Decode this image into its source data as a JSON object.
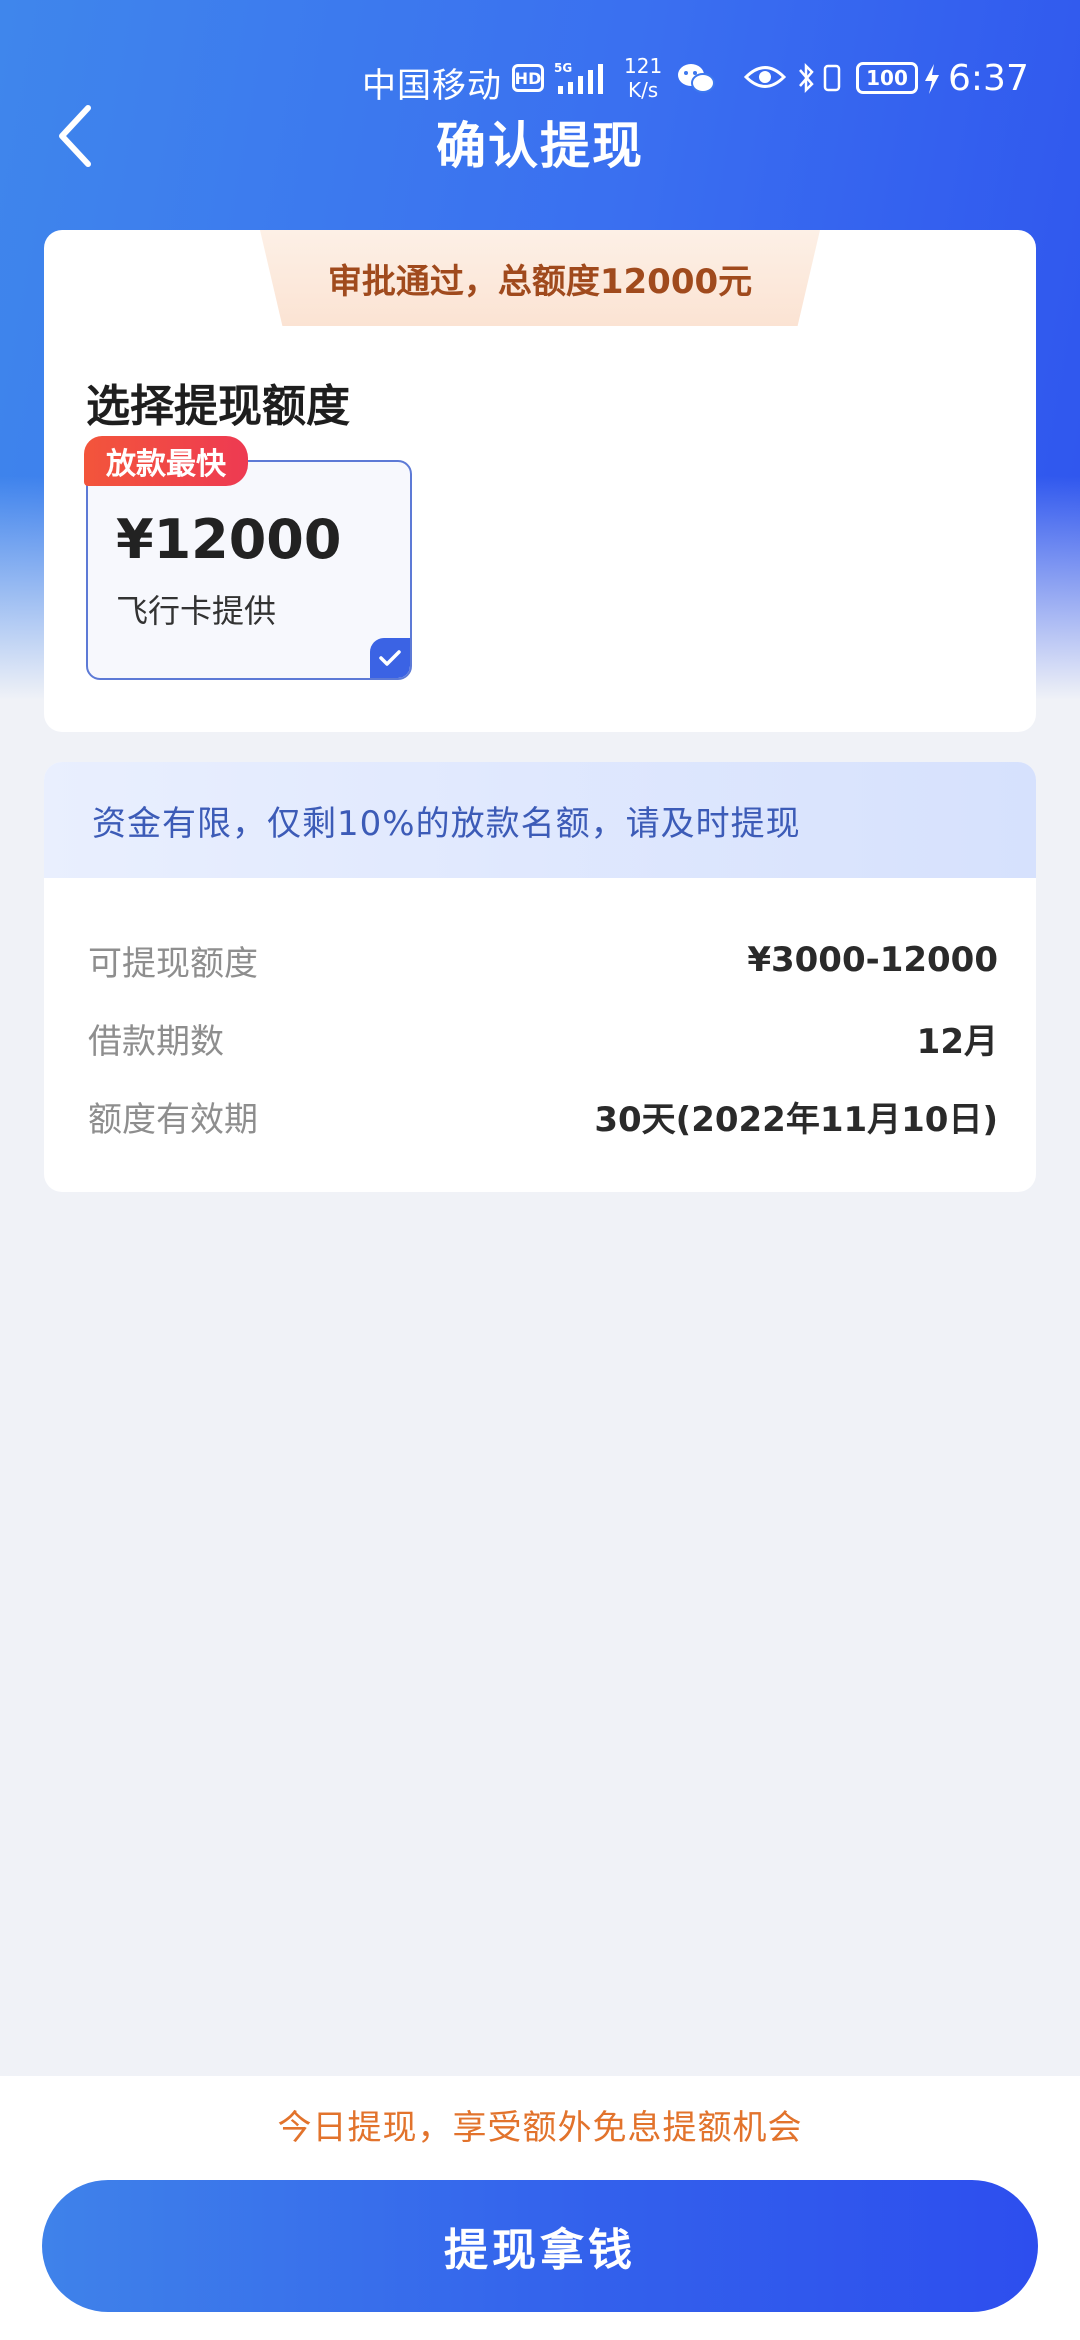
{
  "status_bar": {
    "carrier": "中国移动",
    "hd": "HD",
    "network": "5G",
    "speed_value": "121",
    "speed_unit": "K/s",
    "battery": "100",
    "time": "6:37",
    "icons": [
      "hd-icon",
      "signal-icon",
      "wechat-icon",
      "eye-icon",
      "bluetooth-icon",
      "vibrate-icon",
      "battery-icon",
      "charging-icon"
    ]
  },
  "header": {
    "title": "确认提现",
    "back_icon": "chevron-left-icon"
  },
  "approval": {
    "text": "审批通过，总额度12000元"
  },
  "amount_select": {
    "title": "选择提现额度",
    "tag": "放款最快",
    "amount": "¥12000",
    "provider": "飞行卡提供",
    "selected": true
  },
  "notice": {
    "text": "资金有限，仅剩10%的放款名额，请及时提现"
  },
  "details": [
    {
      "label": "可提现额度",
      "value": "¥3000-12000"
    },
    {
      "label": "借款期数",
      "value": "12月"
    },
    {
      "label": "额度有效期",
      "value": "30天(2022年11月10日)"
    }
  ],
  "bottom": {
    "promo": "今日提现，享受额外免息提额机会",
    "button": "提现拿钱"
  },
  "colors": {
    "primary_blue": "#3361ec",
    "banner_text": "#a04a1d",
    "promo_orange": "#e2732c",
    "tag_red": "#ee3a52"
  }
}
